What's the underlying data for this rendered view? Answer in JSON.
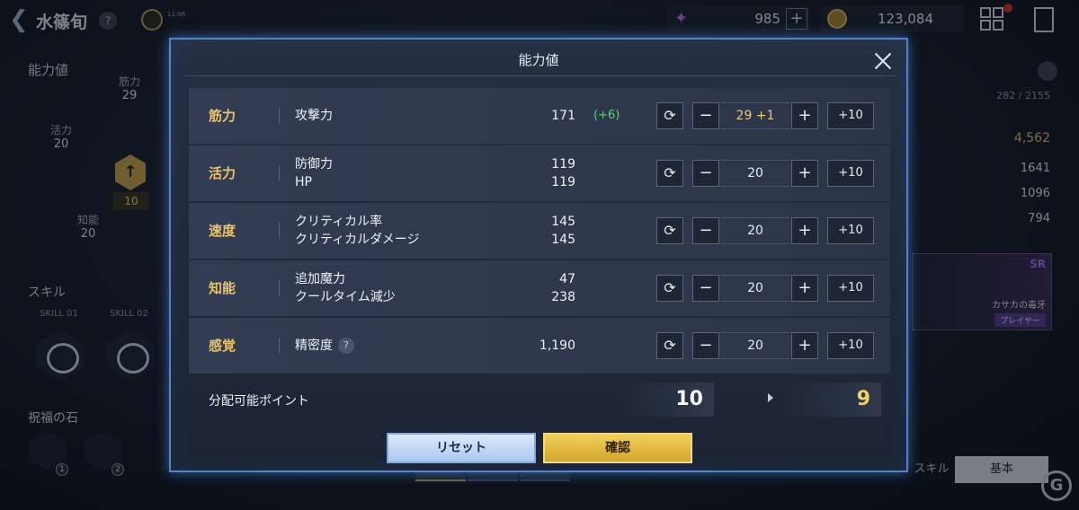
{
  "header": {
    "character_name": "水篠旬",
    "help_symbol": "?",
    "timer_text": "11:08",
    "gems": "985",
    "gold": "123,084"
  },
  "left_panel": {
    "title": "能力値",
    "stats": [
      {
        "label": "筋力",
        "value": "29"
      },
      {
        "label": "活力",
        "value": "20"
      },
      {
        "label": "知能",
        "value": "20"
      }
    ],
    "level_points": "10",
    "skills_title": "スキル",
    "skill_slots": [
      "SKILL 01",
      "SKILL 02"
    ],
    "stones_title": "祝福の石",
    "stone_slots": [
      "1",
      "2"
    ]
  },
  "right_panel": {
    "count": "282 / 2155",
    "power": "4,562",
    "hp": "1641",
    "attack": "1096",
    "defense": "794",
    "weapon_rarity": "SR",
    "weapon_name": "カサカの毒牙",
    "weapon_tag": "プレイヤー",
    "tabs": [
      "スキル",
      "基本"
    ]
  },
  "modal": {
    "title": "能力値",
    "rows": [
      {
        "name": "筋力",
        "attrs": [
          "攻撃力"
        ],
        "values": [
          "171"
        ],
        "bonus": "(+6)",
        "points": "29 +1"
      },
      {
        "name": "活力",
        "attrs": [
          "防御力",
          "HP"
        ],
        "values": [
          "119",
          "119"
        ],
        "bonus": "",
        "points": "20"
      },
      {
        "name": "速度",
        "attrs": [
          "クリティカル率",
          "クリティカルダメージ"
        ],
        "values": [
          "145",
          "145"
        ],
        "bonus": "",
        "points": "20"
      },
      {
        "name": "知能",
        "attrs": [
          "追加魔力",
          "クールタイム減少"
        ],
        "values": [
          "47",
          "238"
        ],
        "bonus": "",
        "points": "20"
      },
      {
        "name": "感覚",
        "attrs": [
          "精密度"
        ],
        "values": [
          "1,190"
        ],
        "bonus": "",
        "points": "20"
      }
    ],
    "minus_label": "−",
    "plus_label": "+",
    "plus10_label": "+10",
    "reset_icon": "⟳",
    "points_label": "分配可能ポイント",
    "points_current": "10",
    "points_after": "9",
    "reset_button": "リセット",
    "confirm_button": "確認"
  },
  "colors": {
    "accent_gold": "#e7c36a",
    "bonus_green": "#5fd07a",
    "modal_border": "#4f86c9"
  }
}
